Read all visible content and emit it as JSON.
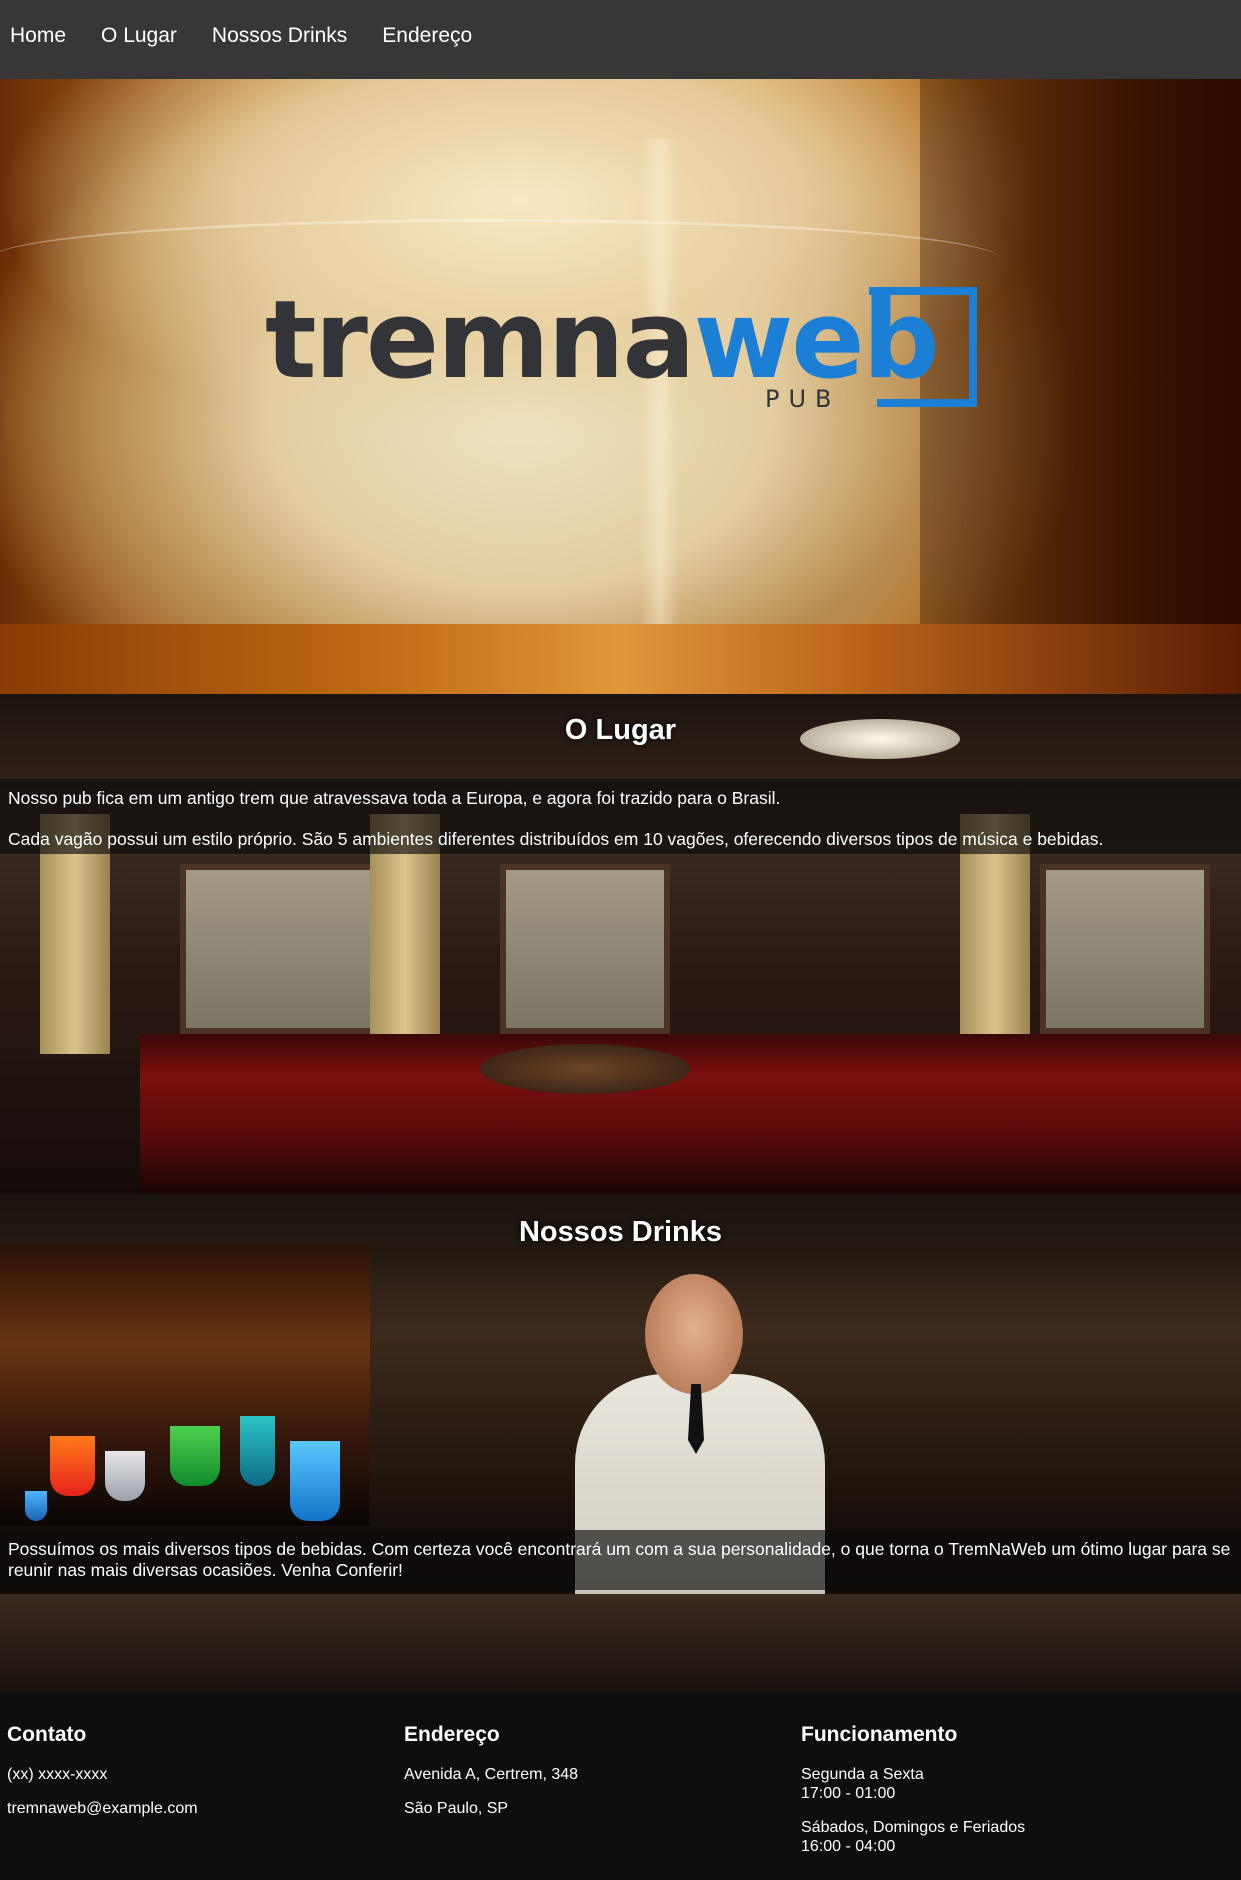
{
  "nav": {
    "items": [
      "Home",
      "O Lugar",
      "Nossos Drinks",
      "Endereço"
    ]
  },
  "hero": {
    "logo_part1": "tremna",
    "logo_part2": "web",
    "logo_sub": "PUB"
  },
  "colors": {
    "nav_bg": "#373737",
    "logo_blue": "#1c7fd6",
    "logo_gray": "#333438",
    "footer_bg": "#0e0e0e"
  },
  "lugar": {
    "title": "O Lugar",
    "p1": "Nosso pub fica em um antigo trem que atravessava toda a Europa, e agora foi trazido para o Brasil.",
    "p2": "Cada vagão possui um estilo próprio. São 5 ambientes diferentes distribuídos em 10 vagões, oferecendo diversos tipos de música e bebidas."
  },
  "drinks": {
    "title": "Nossos Drinks",
    "p1": "Possuímos os mais diversos tipos de bebidas. Com certeza você encontrará um com a sua personalidade, o que torna o TremNaWeb um ótimo lugar para se reunir nas mais diversas ocasiões. Venha Conferir!"
  },
  "footer": {
    "contato": {
      "title": "Contato",
      "phone": "(xx) xxxx-xxxx",
      "email": "tremnaweb@example.com"
    },
    "endereco": {
      "title": "Endereço",
      "line1": "Avenida A, Certrem, 348",
      "line2": "São Paulo, SP"
    },
    "funcionamento": {
      "title": "Funcionamento",
      "days1": "Segunda a Sexta",
      "hours1": "17:00 - 01:00",
      "days2": "Sábados, Domingos e Feriados",
      "hours2": "16:00 - 04:00"
    }
  }
}
